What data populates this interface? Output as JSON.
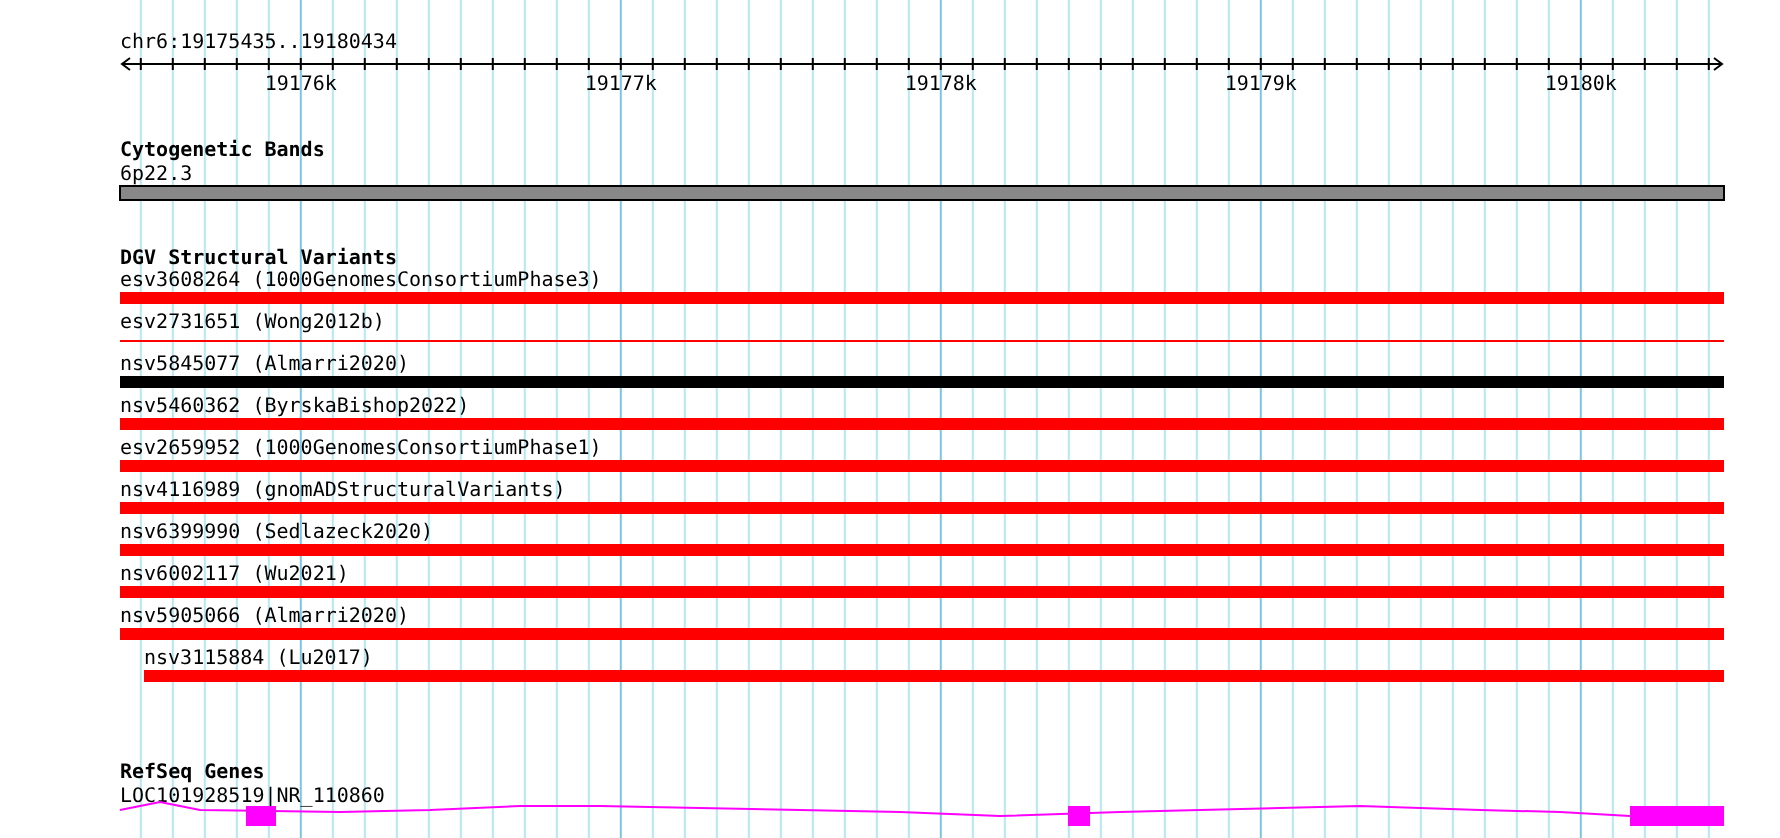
{
  "ruler": {
    "position": "chr6:19175435..19180434",
    "ticks": [
      "19176k",
      "19177k",
      "19178k",
      "19179k",
      "19180k"
    ]
  },
  "cytogenetic_bands": {
    "title": "Cytogenetic Bands",
    "band": "6p22.3"
  },
  "dgv_structural_variants": {
    "title": "DGV Structural Variants",
    "items": [
      {
        "label": "esv3608264 (1000GenomesConsortiumPhase3)",
        "color": "#ff0000",
        "kind": "full"
      },
      {
        "label": "esv2731651 (Wong2012b)",
        "color": "#ff0000",
        "kind": "thin"
      },
      {
        "label": "nsv5845077 (Almarri2020)",
        "color": "#000000",
        "kind": "full"
      },
      {
        "label": "nsv5460362 (ByrskaBishop2022)",
        "color": "#ff0000",
        "kind": "full"
      },
      {
        "label": "esv2659952 (1000GenomesConsortiumPhase1)",
        "color": "#ff0000",
        "kind": "full"
      },
      {
        "label": "nsv4116989 (gnomADStructuralVariants)",
        "color": "#ff0000",
        "kind": "full"
      },
      {
        "label": "nsv6399990 (Sedlazeck2020)",
        "color": "#ff0000",
        "kind": "full"
      },
      {
        "label": "nsv6002117 (Wu2021)",
        "color": "#ff0000",
        "kind": "full"
      },
      {
        "label": "nsv5905066 (Almarri2020)",
        "color": "#ff0000",
        "kind": "full"
      },
      {
        "label": "nsv3115884 (Lu2017)",
        "color": "#ff0000",
        "kind": "partial"
      }
    ]
  },
  "refseq_genes": {
    "title": "RefSeq Genes",
    "gene": "LOC101928519|NR_110860"
  }
}
